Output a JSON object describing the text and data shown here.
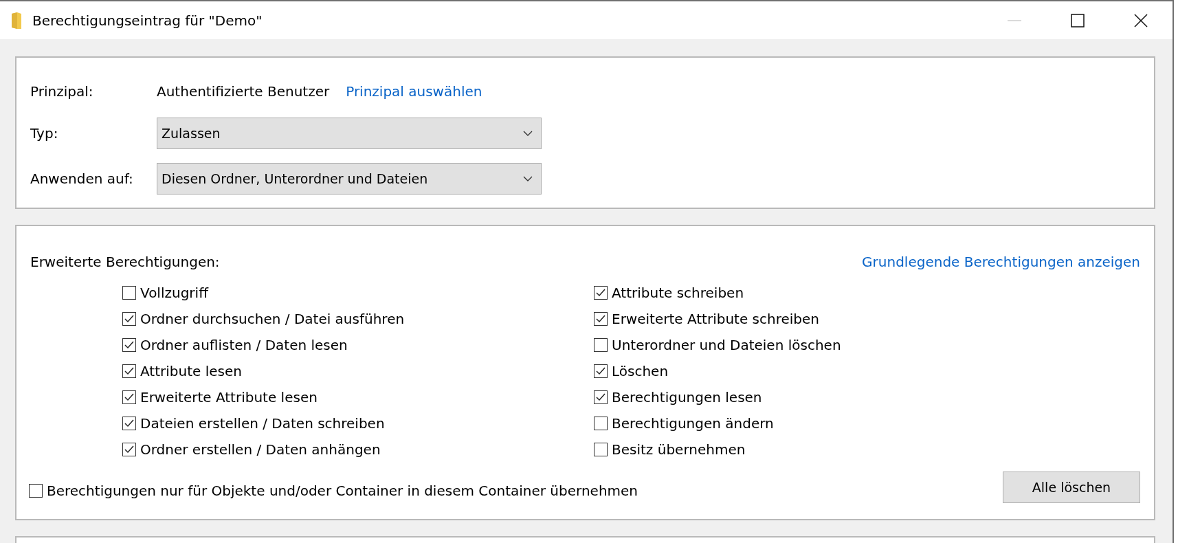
{
  "window": {
    "title": "Berechtigungseintrag für \"Demo\"",
    "minimize_disabled": true
  },
  "principal": {
    "label": "Prinzipal:",
    "value": "Authentifizierte Benutzer",
    "link": "Prinzipal auswählen"
  },
  "fields": [
    {
      "label": "Typ:",
      "value": "Zulassen"
    },
    {
      "label": "Anwenden auf:",
      "value": "Diesen Ordner, Unterordner und Dateien"
    }
  ],
  "permissions": {
    "heading": "Erweiterte Berechtigungen:",
    "link": "Grundlegende Berechtigungen anzeigen",
    "columns": [
      [
        {
          "label": "Vollzugriff",
          "checked": false
        },
        {
          "label": "Ordner durchsuchen / Datei ausführen",
          "checked": true
        },
        {
          "label": "Ordner auflisten / Daten lesen",
          "checked": true
        },
        {
          "label": "Attribute lesen",
          "checked": true
        },
        {
          "label": "Erweiterte Attribute lesen",
          "checked": true
        },
        {
          "label": "Dateien erstellen / Daten schreiben",
          "checked": true
        },
        {
          "label": "Ordner erstellen / Daten anhängen",
          "checked": true
        }
      ],
      [
        {
          "label": "Attribute schreiben",
          "checked": true
        },
        {
          "label": "Erweiterte Attribute schreiben",
          "checked": true
        },
        {
          "label": "Unterordner und Dateien löschen",
          "checked": false
        },
        {
          "label": "Löschen",
          "checked": true
        },
        {
          "label": "Berechtigungen lesen",
          "checked": true
        },
        {
          "label": "Berechtigungen ändern",
          "checked": false
        },
        {
          "label": "Besitz übernehmen",
          "checked": false
        }
      ]
    ],
    "inherit": {
      "label": "Berechtigungen nur für Objekte und/oder Container in diesem Container übernehmen",
      "checked": false
    },
    "clear_button": "Alle löschen"
  }
}
